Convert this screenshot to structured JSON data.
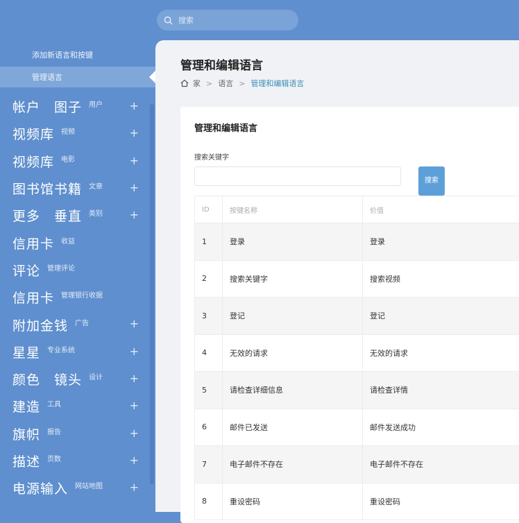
{
  "search": {
    "placeholder": "搜索"
  },
  "sidebar": {
    "sub_add": "添加新语言和按键",
    "sub_active": "管理语言",
    "items": [
      {
        "main": "帐户　图子",
        "sub": "用户",
        "plus": "+"
      },
      {
        "main": "视频库",
        "sub": "视频",
        "plus": "+"
      },
      {
        "main": "视频库",
        "sub": "电影",
        "plus": "+"
      },
      {
        "main": "图书馆书籍",
        "sub": "文章",
        "plus": "+"
      },
      {
        "main": "更多　垂直",
        "sub": "类别",
        "plus": "+"
      },
      {
        "main": "信用卡",
        "sub": "收益",
        "plus": ""
      },
      {
        "main": "评论",
        "sub": "管理评论",
        "plus": ""
      },
      {
        "main": "信用卡",
        "sub": "管理银行收据",
        "plus": ""
      },
      {
        "main": "附加金钱",
        "sub": "广告",
        "plus": "+"
      },
      {
        "main": "星星",
        "sub": "专业系统",
        "plus": "+"
      },
      {
        "main": "颜色　镜头",
        "sub": "设计",
        "plus": "+"
      },
      {
        "main": "建造",
        "sub": "工具",
        "plus": "+"
      },
      {
        "main": "旗帜",
        "sub": "报告",
        "plus": "+"
      },
      {
        "main": "描述",
        "sub": "页数",
        "plus": "+"
      },
      {
        "main": "电源输入",
        "sub": "网站地图",
        "plus": "+"
      }
    ]
  },
  "main": {
    "title": "管理和编辑语言",
    "breadcrumb": {
      "home": "家",
      "lang": "语言",
      "current": "管理和编辑语言",
      "sep": ">"
    },
    "card": {
      "title": "管理和编辑语言",
      "field_label": "搜索关键字",
      "search_button": "搜索",
      "headers": {
        "id": "ID",
        "name": "按键名称",
        "value": "价值"
      },
      "rows": [
        {
          "id": "1",
          "name": "登录",
          "value": "登录"
        },
        {
          "id": "2",
          "name": "搜索关键字",
          "value": "搜索视频"
        },
        {
          "id": "3",
          "name": "登记",
          "value": "登记"
        },
        {
          "id": "4",
          "name": "无效的请求",
          "value": "无效的请求"
        },
        {
          "id": "5",
          "name": "请检查详细信息",
          "value": "请检查详情"
        },
        {
          "id": "6",
          "name": "邮件已发送",
          "value": "邮件发送成功"
        },
        {
          "id": "7",
          "name": "电子邮件不存在",
          "value": "电子邮件不存在"
        },
        {
          "id": "8",
          "name": "重设密码",
          "value": "重设密码"
        }
      ]
    }
  }
}
